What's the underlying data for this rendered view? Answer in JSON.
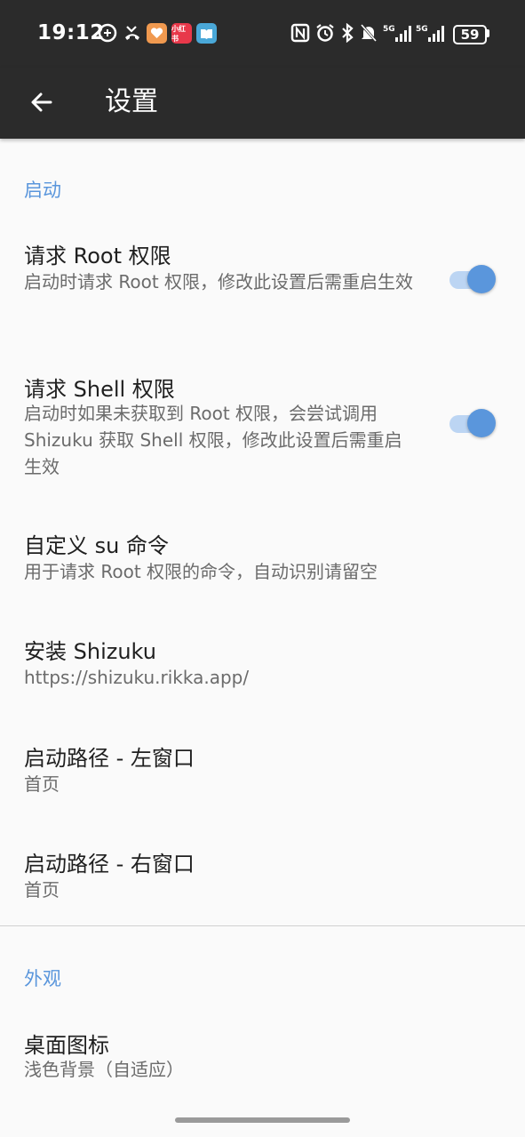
{
  "status_bar": {
    "time": "19:12",
    "battery": "59",
    "icons": [
      "usb-debug-icon",
      "missed-call-icon",
      "app-health-icon",
      "app-xiaohongshu-icon",
      "app-reader-icon",
      "nfc-icon",
      "alarm-icon",
      "bluetooth-icon",
      "mute-icon",
      "signal-5g-icon",
      "signal-5g-icon-2"
    ],
    "app_badge_label": "小红书"
  },
  "app_bar": {
    "title": "设置",
    "back_icon": "arrow-back-icon"
  },
  "colors": {
    "accent": "#5a96dc",
    "bar_background": "#2b2b2b",
    "page_background": "#fafafa"
  },
  "sections": [
    {
      "header": "启动",
      "items": [
        {
          "title": "请求 Root 权限",
          "summary": "启动时请求 Root 权限，修改此设置后需重启生效",
          "switch": true
        },
        {
          "title": "请求 Shell 权限",
          "summary": "启动时如果未获取到 Root 权限，会尝试调用 Shizuku 获取 Shell 权限，修改此设置后需重启生效",
          "switch": true
        },
        {
          "title": "自定义 su 命令",
          "summary": "用于请求 Root 权限的命令，自动识别请留空"
        },
        {
          "title": "安装 Shizuku",
          "summary": "https://shizuku.rikka.app/"
        },
        {
          "title": "启动路径 - 左窗口",
          "summary": "首页"
        },
        {
          "title": "启动路径 - 右窗口",
          "summary": "首页"
        }
      ]
    },
    {
      "header": "外观",
      "items": [
        {
          "title": "桌面图标",
          "summary": "浅色背景（自适应）"
        }
      ]
    }
  ]
}
